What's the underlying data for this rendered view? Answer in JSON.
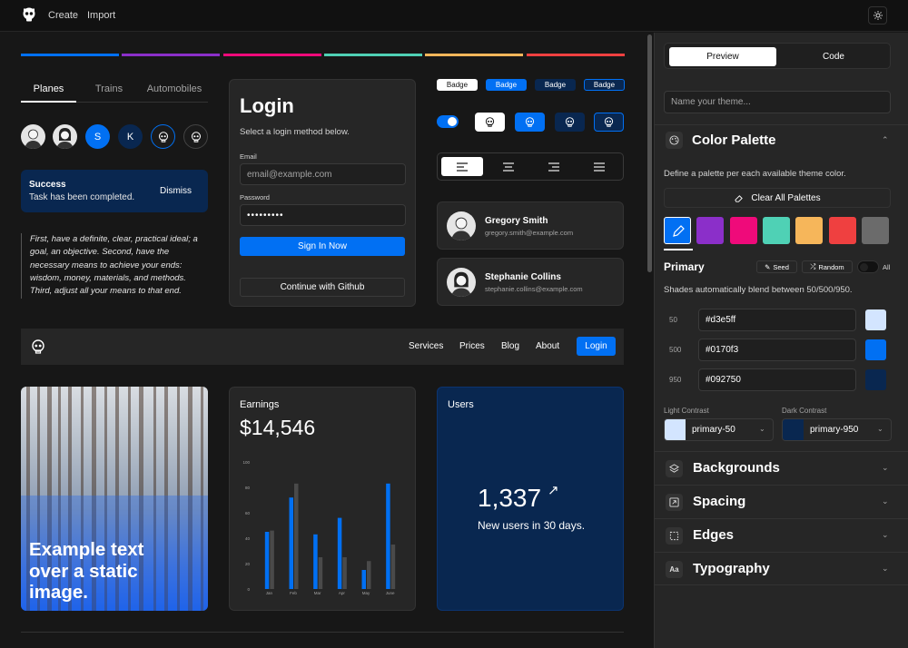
{
  "topbar": {
    "create": "Create",
    "import": "Import"
  },
  "stripes": [
    "#0170f3",
    "#8b2fc9",
    "#ef0a7a",
    "#4fd1b5",
    "#f6b65a",
    "#ef4040"
  ],
  "tabs": [
    "Planes",
    "Trains",
    "Automobiles"
  ],
  "avatars": {
    "s": "S",
    "k": "K"
  },
  "alert": {
    "title": "Success",
    "text": "Task has been completed.",
    "dismiss": "Dismiss"
  },
  "quote": "First, have a definite, clear, practical ideal; a goal, an objective. Second, have the necessary means to achieve your ends: wisdom, money, materials, and methods. Third, adjust all your means to that end.",
  "login": {
    "title": "Login",
    "subtitle": "Select a login method below.",
    "email_label": "Email",
    "email_placeholder": "email@example.com",
    "password_label": "Password",
    "password_value": "•••••••••",
    "signin": "Sign In Now",
    "github": "Continue with Github"
  },
  "badges": [
    "Badge",
    "Badge",
    "Badge",
    "Badge"
  ],
  "users": [
    {
      "name": "Gregory Smith",
      "email": "gregory.smith@example.com"
    },
    {
      "name": "Stephanie Collins",
      "email": "stephanie.collins@example.com"
    }
  ],
  "navbar": {
    "links": [
      "Services",
      "Prices",
      "Blog",
      "About"
    ],
    "login": "Login"
  },
  "image_card": {
    "text": "Example text over a static image."
  },
  "earnings": {
    "label": "Earnings",
    "value": "$14,546"
  },
  "users_card": {
    "label": "Users",
    "value": "1,337",
    "arrow": "↗",
    "caption": "New users in 30 days."
  },
  "chart_data": {
    "type": "bar",
    "categories": [
      "Jan",
      "Feb",
      "Mar",
      "Apr",
      "May",
      "June"
    ],
    "series": [
      {
        "values": [
          45,
          72,
          43,
          56,
          15,
          83
        ]
      },
      {
        "values": [
          46,
          83,
          25,
          25,
          22,
          35
        ]
      }
    ],
    "ylim": [
      0,
      100
    ],
    "yticks": [
      "100",
      "80",
      "60",
      "40",
      "20",
      "0"
    ]
  },
  "side": {
    "tabs": {
      "preview": "Preview",
      "code": "Code"
    },
    "theme_placeholder": "Name your theme...",
    "palette_title": "Color Palette",
    "palette_desc": "Define a palette per each available theme color.",
    "clear": "Clear All Palettes",
    "swatches": [
      "#0170f3",
      "#8b2fc9",
      "#ef0a7a",
      "#4fd1b5",
      "#f6b65a",
      "#ef4040",
      "#6b6b6b"
    ],
    "primary": {
      "title": "Primary",
      "seed": "Seed",
      "random": "Random",
      "all": "All",
      "desc": "Shades automatically blend between 50/500/950."
    },
    "shades": [
      {
        "label": "50",
        "hex": "#d3e5ff",
        "color": "#d3e5ff"
      },
      {
        "label": "500",
        "hex": "#0170f3",
        "color": "#0170f3"
      },
      {
        "label": "950",
        "hex": "#092750",
        "color": "#092750"
      }
    ],
    "contrast": {
      "light_label": "Light Contrast",
      "light_value": "primary-50",
      "dark_label": "Dark Contrast",
      "dark_value": "primary-950"
    },
    "sections": [
      "Backgrounds",
      "Spacing",
      "Edges",
      "Typography"
    ]
  }
}
